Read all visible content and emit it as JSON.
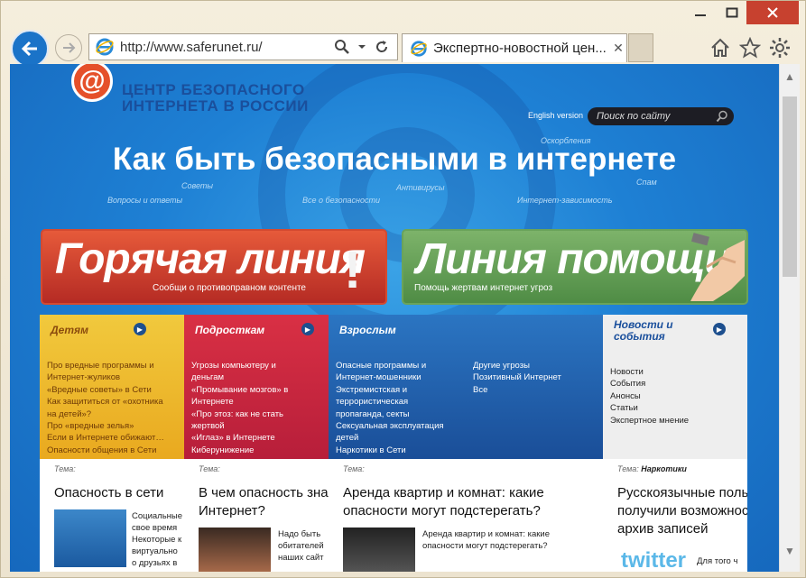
{
  "browser": {
    "url": "http://www.saferunet.ru/",
    "tab_title": "Экспертно-новостной цен...",
    "tab_close": "✕"
  },
  "site": {
    "logo_text": "ЦЕНТР БЕЗОПАСНОГО ИНТЕРНЕТА В РОССИИ",
    "logo_line1": "ЦЕНТР БЕЗОПАСНОГО",
    "logo_line2": "ИНТЕРНЕТА В РОССИИ",
    "english": "English version",
    "search_placeholder": "Поиск по сайту",
    "hero": "Как быть безопасными в интернете",
    "tags": [
      "Советы",
      "Вопросы и ответы",
      "Все о безопасности",
      "Антивирусы",
      "Оскорбления",
      "Спам",
      "Интернет-зависимость"
    ]
  },
  "banners": {
    "hot_title": "Горячая линия",
    "hot_sub": "Сообщи о противоправном контенте",
    "help_title": "Линия помощи",
    "help_sub": "Помощь жертвам интернет угроз"
  },
  "columns": {
    "kids": {
      "title": "Детям",
      "items": [
        "Про вредные программы и",
        "Интернет-жуликов",
        "«Вредные советы» в Сети",
        "Как защититься от «охотника",
        "на детей»?",
        "Про «вредные зелья»",
        "Если в Интернете обижают…",
        "Опасности общения в Сети"
      ]
    },
    "teens": {
      "title": "Подросткам",
      "items": [
        "Угрозы компьютеру и",
        "деньгам",
        "«Промывание мозгов» в",
        "Интернете",
        "«Про этоз: как не стать",
        "жертвой",
        "«Иглаз» в Интернете",
        "Киберунижение"
      ]
    },
    "adults": {
      "title": "Взрослым",
      "items_left": [
        "Опасные программы и",
        "Интернет-мошенники",
        "Экстремистская и",
        "террористическая",
        "пропаганда, секты",
        "Сексуальная эксплуатация",
        "детей",
        "Наркотики в Сети"
      ],
      "items_right": [
        "Другие угрозы",
        "Позитивный Интернет",
        "Все"
      ]
    },
    "news": {
      "title_line1": "Новости и",
      "title_line2": "события",
      "items": [
        "Новости",
        "События",
        "Анонсы",
        "Статьи",
        "Экспертное мнение"
      ]
    }
  },
  "articles": [
    {
      "theme": "Тема:",
      "theme_value": "",
      "title": "Опасность в сети",
      "desc": "Социальные\nсвое время\nНекоторые к\nвиртуально\nо друзьях в"
    },
    {
      "theme": "Тема:",
      "theme_value": "",
      "title": "В чем опасность зна\nИнтернет?",
      "desc": "Надо быть\nобитателей\nнаших сайт"
    },
    {
      "theme": "Тема:",
      "theme_value": "",
      "title": "Аренда квартир и комнат: какие\nопасности могут подстерегать?",
      "desc": "Аренда квартир и комнат: какие\nопасности могут подстерегать?"
    },
    {
      "theme": "Тема:",
      "theme_value": "Наркотики",
      "title": "Русскоязычные поль\nполучили возможност\nархив записей",
      "desc": "Для того ч",
      "logo": "twitter"
    }
  ]
}
